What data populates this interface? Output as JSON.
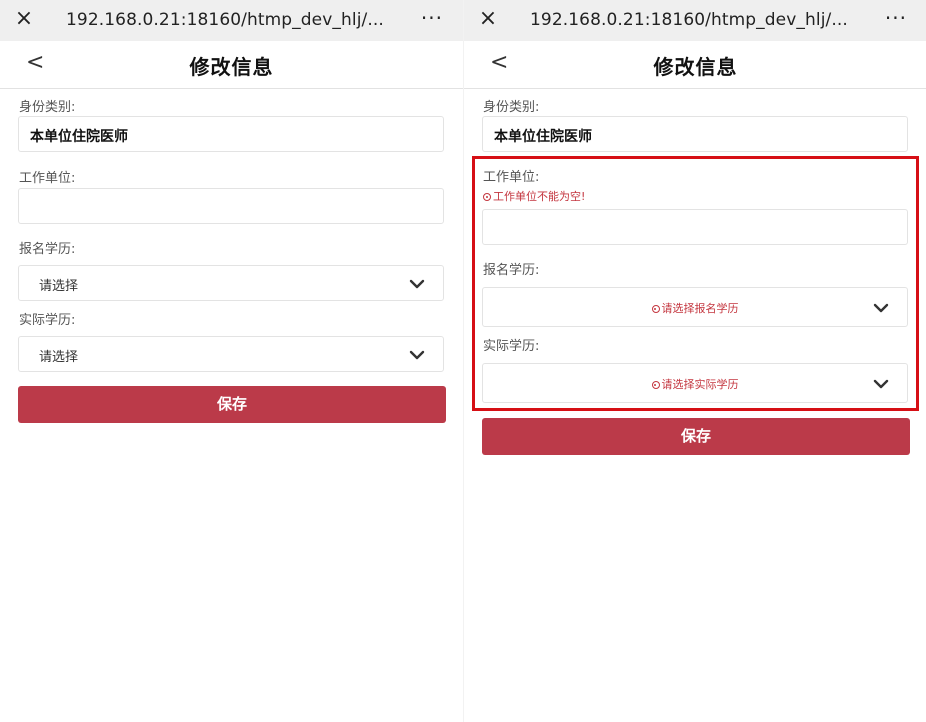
{
  "browser": {
    "url": "192.168.0.21:18160/htmp_dev_hlj/...",
    "close_icon": "×",
    "more_icon": "···"
  },
  "page": {
    "back_icon": "<",
    "title": "修改信息"
  },
  "form": {
    "identity_label": "身份类别:",
    "identity_value": "本单位住院医师",
    "workplace_label": "工作单位:",
    "workplace_value": "",
    "signup_edu_label": "报名学历:",
    "actual_edu_label": "实际学历:",
    "select_placeholder": "请选择",
    "save_label": "保存"
  },
  "errors": {
    "workplace_required": "工作单位不能为空!",
    "signup_edu_required": "请选择报名学历",
    "actual_edu_required": "请选择实际学历"
  },
  "colors": {
    "accent": "#bb3a49",
    "error": "#c4363f",
    "highlight": "#d60f15"
  }
}
